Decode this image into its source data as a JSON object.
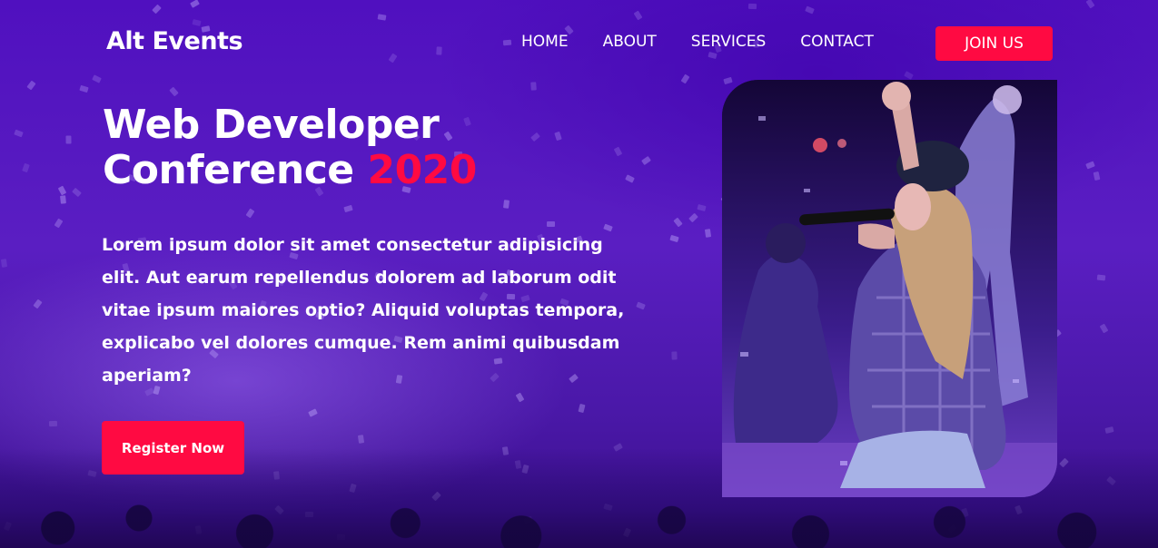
{
  "navbar": {
    "logo": "Alt Events",
    "links": [
      {
        "label": "HOME"
      },
      {
        "label": "ABOUT"
      },
      {
        "label": "SERVICES"
      },
      {
        "label": "CONTACT"
      }
    ],
    "cta_label": "JOIN US"
  },
  "hero": {
    "title_line1": "Web Developer",
    "title_line2": "Conference",
    "title_year": "2020",
    "description": "Lorem ipsum dolor sit amet consectetur adipisicing elit. Aut earum repellendus dolorem ad laborum odit vitae ipsum maiores optio? Aliquid voluptas tempora, explicabo vel dolores cumque. Rem animi quibusdam aperiam?",
    "register_label": "Register Now"
  },
  "colors": {
    "accent": "#ff0a42",
    "background": "#4a10b8",
    "text": "#ffffff"
  }
}
